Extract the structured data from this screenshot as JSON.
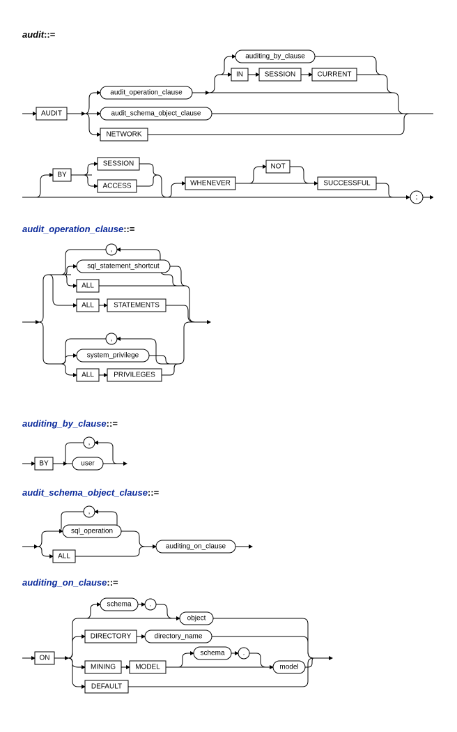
{
  "sections": {
    "audit": {
      "title": "audit",
      "suffix": "::="
    },
    "audit_operation_clause": {
      "title": "audit_operation_clause",
      "suffix": "::="
    },
    "auditing_by_clause": {
      "title": "auditing_by_clause",
      "suffix": "::="
    },
    "audit_schema_object_clause": {
      "title": "audit_schema_object_clause",
      "suffix": "::="
    },
    "auditing_on_clause": {
      "title": "auditing_on_clause",
      "suffix": "::="
    }
  },
  "tokens": {
    "AUDIT": "AUDIT",
    "audit_operation_clause": "audit_operation_clause",
    "audit_schema_object_clause": "audit_schema_object_clause",
    "NETWORK": "NETWORK",
    "auditing_by_clause": "auditing_by_clause",
    "IN": "IN",
    "SESSION": "SESSION",
    "CURRENT": "CURRENT",
    "BY": "BY",
    "ACCESS": "ACCESS",
    "WHENEVER": "WHENEVER",
    "NOT": "NOT",
    "SUCCESSFUL": "SUCCESSFUL",
    "semicolon": ";",
    "comma": ",",
    "sql_statement_shortcut": "sql_statement_shortcut",
    "ALL": "ALL",
    "STATEMENTS": "STATEMENTS",
    "system_privilege": "system_privilege",
    "PRIVILEGES": "PRIVILEGES",
    "user": "user",
    "sql_operation": "sql_operation",
    "auditing_on_clause": "auditing_on_clause",
    "ON": "ON",
    "schema": "schema",
    "dot": ".",
    "object": "object",
    "DIRECTORY": "DIRECTORY",
    "directory_name": "directory_name",
    "MINING": "MINING",
    "MODEL": "MODEL",
    "model": "model",
    "DEFAULT": "DEFAULT"
  },
  "chart_data": {
    "type": "railroad-diagram",
    "rules": [
      {
        "name": "audit",
        "body": "AUDIT ( audit_operation_clause [ auditing_by_clause | IN SESSION CURRENT ] | audit_schema_object_clause | NETWORK ) [ BY ( SESSION | ACCESS ) ] [ WHENEVER [ NOT ] SUCCESSFUL ] ;"
      },
      {
        "name": "audit_operation_clause",
        "body": "( { sql_statement_shortcut | ALL | ALL STATEMENTS } [, ...] ) | ( { system_privilege | ALL PRIVILEGES } [, ...] )"
      },
      {
        "name": "auditing_by_clause",
        "body": "BY user [, user ...]"
      },
      {
        "name": "audit_schema_object_clause",
        "body": "( sql_operation [, ...] | ALL ) auditing_on_clause"
      },
      {
        "name": "auditing_on_clause",
        "body": "ON ( [ schema . ] object | DIRECTORY directory_name | MINING MODEL [ schema . ] model | DEFAULT )"
      }
    ]
  }
}
